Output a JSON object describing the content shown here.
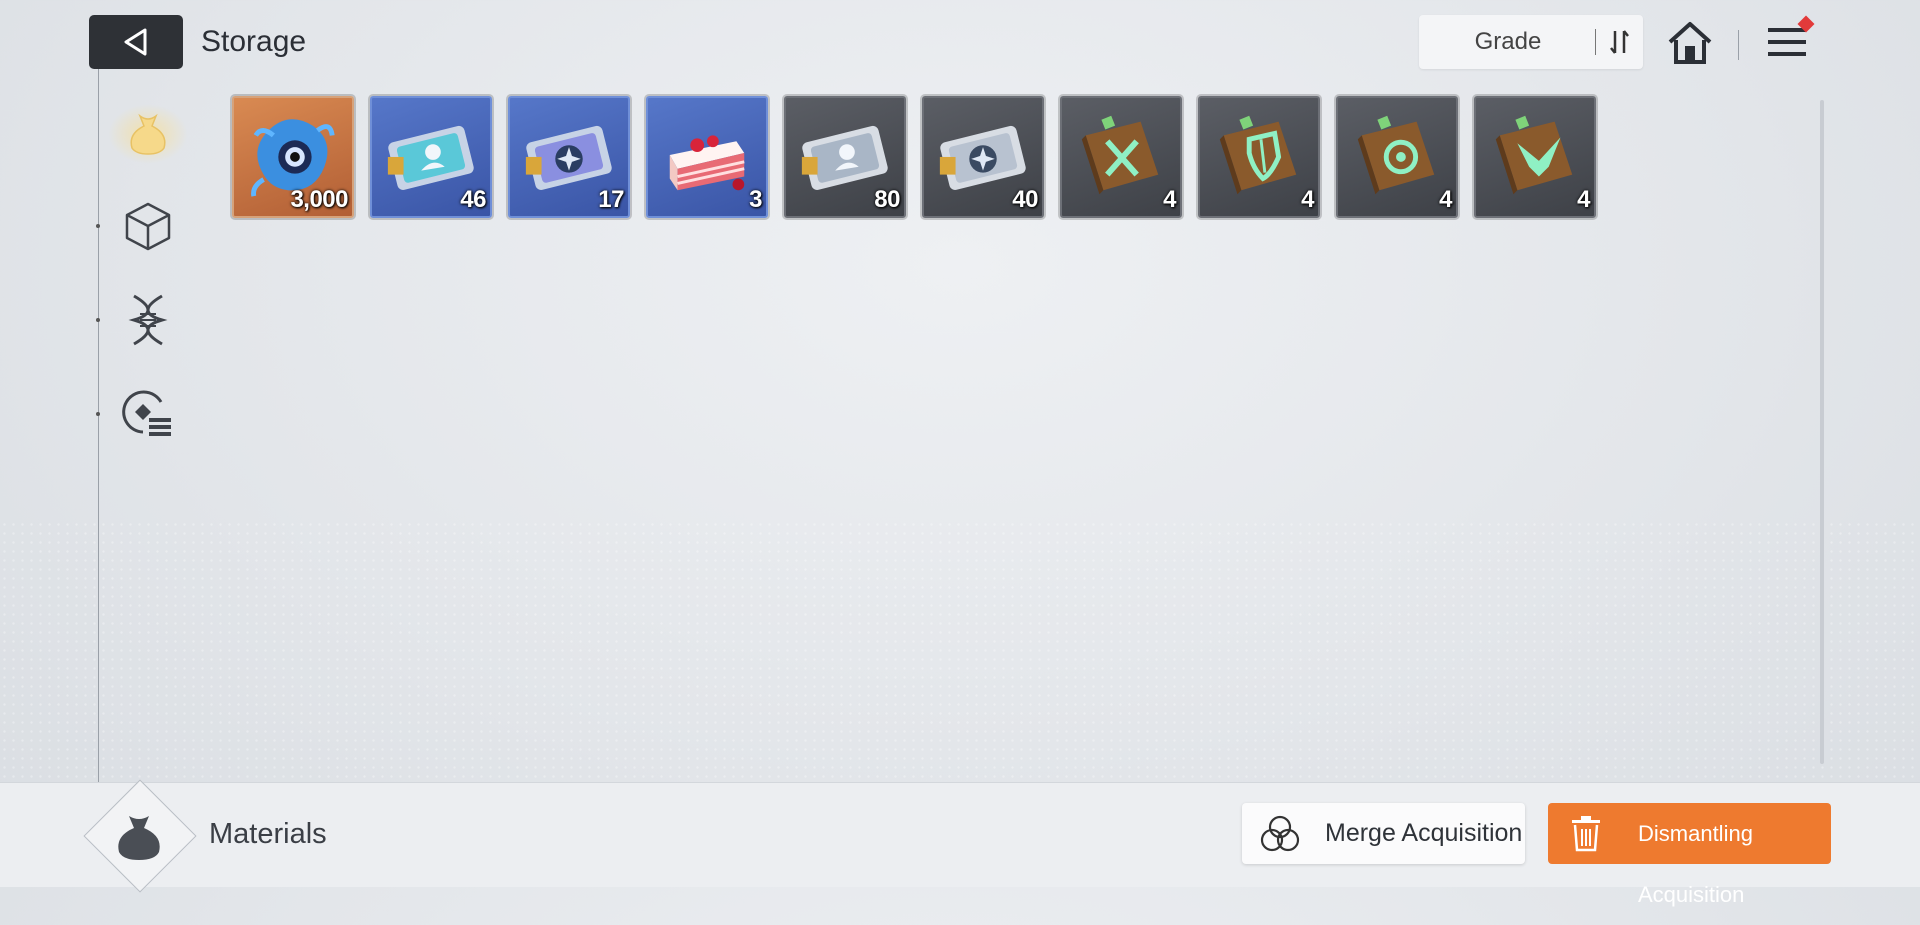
{
  "header": {
    "title": "Storage",
    "sort_label": "Grade"
  },
  "sidebar": {
    "items": [
      {
        "icon": "money-bag-icon",
        "active": true
      },
      {
        "icon": "cube-icon",
        "active": false
      },
      {
        "icon": "dna-icon",
        "active": false
      },
      {
        "icon": "target-list-icon",
        "active": false
      }
    ]
  },
  "items": [
    {
      "icon": "blue-creature-icon",
      "rarity": "orange",
      "quantity": "3,000"
    },
    {
      "icon": "character-ticket-icon",
      "rarity": "blue",
      "quantity": "46"
    },
    {
      "icon": "compass-ticket-icon",
      "rarity": "blue",
      "quantity": "17"
    },
    {
      "icon": "cake-slice-icon",
      "rarity": "blue",
      "quantity": "3"
    },
    {
      "icon": "character-ticket-icon",
      "rarity": "gray",
      "quantity": "80"
    },
    {
      "icon": "compass-ticket-icon",
      "rarity": "gray",
      "quantity": "40"
    },
    {
      "icon": "swords-book-icon",
      "rarity": "gray",
      "quantity": "4"
    },
    {
      "icon": "shield-book-icon",
      "rarity": "gray",
      "quantity": "4"
    },
    {
      "icon": "target-book-icon",
      "rarity": "gray",
      "quantity": "4"
    },
    {
      "icon": "wings-book-icon",
      "rarity": "gray",
      "quantity": "4"
    }
  ],
  "footer": {
    "category_label": "Materials",
    "merge_label": "Merge Acquisition",
    "dismantle_label": "Dismantling Acquisition"
  },
  "colors": {
    "dismantle_button": "#ee7a2f",
    "back_button": "#2e3136",
    "notification_dot": "#e23a3a"
  }
}
